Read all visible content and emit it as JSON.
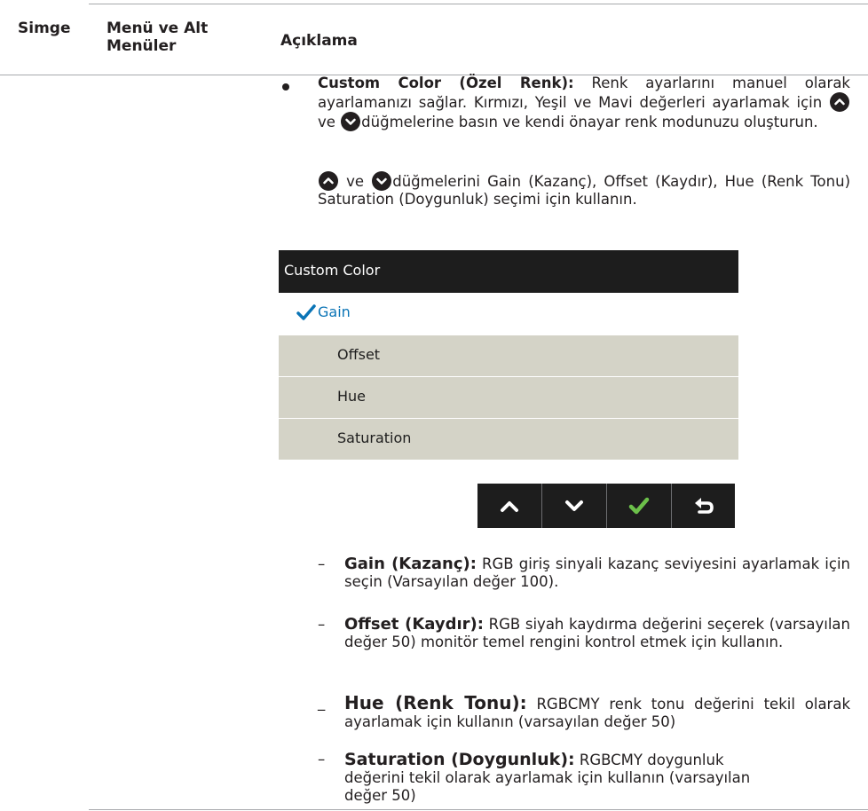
{
  "header": {
    "col_icon": "Simge",
    "col_menu_line1": "Menü ve Alt",
    "col_menu_line2": "Menüler",
    "col_desc": "Açıklama"
  },
  "bullet": {
    "term": "Custom Color (Özel Renk):",
    "text1": " Renk ayarlarını manuel olarak ayarlamanızı sağlar. Kırmızı, Yeşil ve Mavi değerleri ayarlamak için ",
    "and1": " ve ",
    "text2": "düğmelerine basın ve kendi önayar renk modunuzu oluşturun.",
    "and2": " ve ",
    "text3": "düğmelerini Gain (Kazanç), Offset (Kaydır), Hue (Renk Tonu) Saturation (Doygunluk) seçimi için kullanın."
  },
  "osd": {
    "title": "Custom Color",
    "items": [
      "Gain",
      "Offset",
      "Hue",
      "Saturation"
    ],
    "selected": "Gain",
    "colors": {
      "title_bg": "#1d1d1d",
      "row_bg": "#d4d3c7",
      "selected_text": "#0a74b6",
      "check": "#0a74b6"
    }
  },
  "nav_buttons": [
    "chevron-up-icon",
    "chevron-down-icon",
    "checkmark-icon",
    "back-icon"
  ],
  "subitems": [
    {
      "dash": "–",
      "term": "Gain (Kazanç):",
      "text": " RGB giriş sinyali kazanç seviyesini ayarlamak için seçin (Varsayılan değer 100)."
    },
    {
      "dash": "–",
      "term": "Offset (Kaydır):",
      "text": " RGB siyah kaydırma değerini seçerek (varsayılan değer 50) monitör temel rengini kontrol etmek için kullanın."
    },
    {
      "dash": "_",
      "term": "Hue (Renk Tonu):",
      "text": " RGBCMY renk tonu değerini tekil olarak ayarlamak için kullanın (varsayılan değer 50)"
    },
    {
      "dash": "–",
      "term": "Saturation (Doygunluk):",
      "text": " RGBCMY doygunluk değerini tekil olarak ayarlamak için kullanın (varsayılan değer 50)"
    }
  ]
}
